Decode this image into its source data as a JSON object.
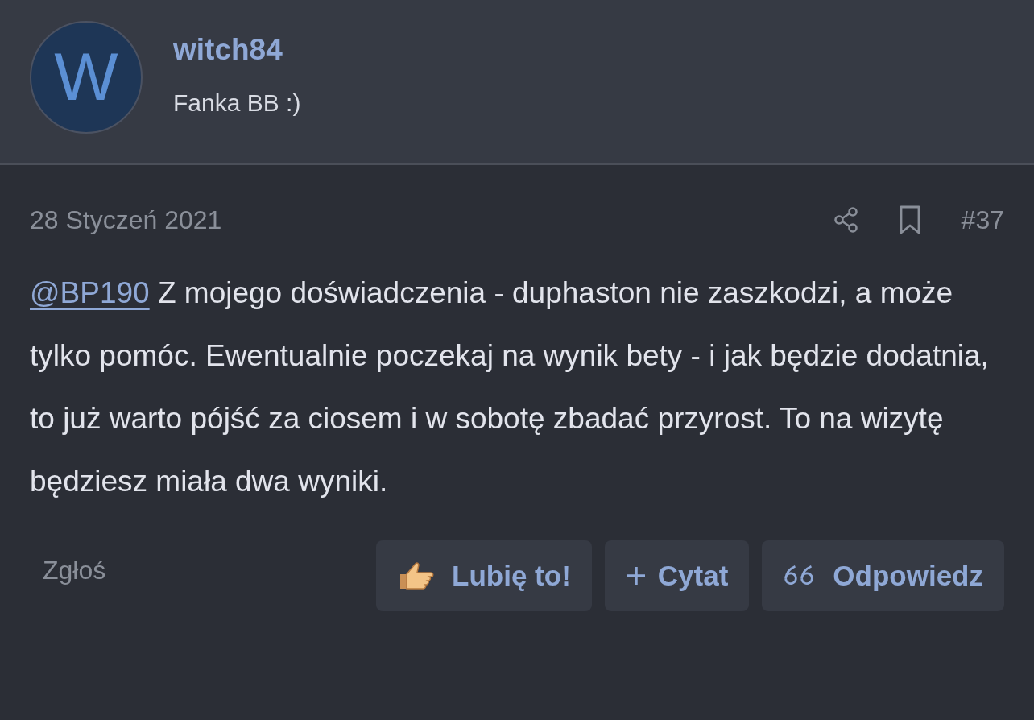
{
  "author": {
    "avatar_letter": "W",
    "name": "witch84",
    "subtitle": "Fanka BB :)"
  },
  "post": {
    "date": "28 Styczeń 2021",
    "number": "#37",
    "mention": "@BP190",
    "text": "Z mojego doświadczenia - duphaston nie zaszkodzi, a może tylko pomóc. Ewentualnie poczekaj na wynik bety - i jak będzie dodatnia, to już warto pójść za ciosem i w sobotę zbadać przyrost. To na wizytę będziesz miała dwa wyniki."
  },
  "report": "Zgłoś",
  "buttons": [
    {
      "kind": "like",
      "label": "Lubię to!"
    },
    {
      "kind": "quote",
      "label": "Cytat"
    },
    {
      "kind": "reply",
      "label": "Odpowiedz"
    }
  ]
}
